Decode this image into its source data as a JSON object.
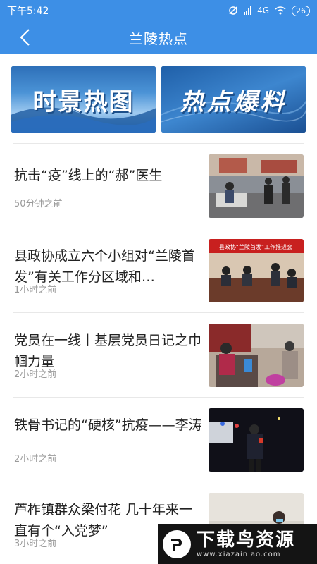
{
  "status_bar": {
    "time": "下午5:42",
    "network": "4G",
    "battery": "26"
  },
  "header": {
    "title": "兰陵热点"
  },
  "banners": [
    {
      "label": "时景热图"
    },
    {
      "label": "热点爆料"
    }
  ],
  "news": [
    {
      "title": "抗击“疫”线上的“郝”医生",
      "time": "50分钟之前"
    },
    {
      "title": "县政协成立六个小组对“兰陵首发”有关工作分区域和…",
      "time": "1小时之前",
      "thumb_caption": "县政协“兰陵首发”工作推进会"
    },
    {
      "title": "党员在一线丨基层党员日记之巾帼力量",
      "time": "2小时之前"
    },
    {
      "title": "铁骨书记的“硬核”抗疫——李涛",
      "time": "2小时之前"
    },
    {
      "title": "芦柞镇群众梁付花 几十年来一直有个“入党梦”",
      "time": "3小时之前"
    }
  ],
  "watermark": {
    "title": "下载鸟资源",
    "url": "www.xiazainiao.com"
  },
  "icons": {
    "back": "chevron-left-icon",
    "battery": "battery-icon",
    "signal": "signal-icon",
    "wifi": "wifi-icon"
  },
  "colors": {
    "header_blue": "#3d8fe6",
    "title_text": "#222222",
    "time_text": "#9a9a9a"
  }
}
